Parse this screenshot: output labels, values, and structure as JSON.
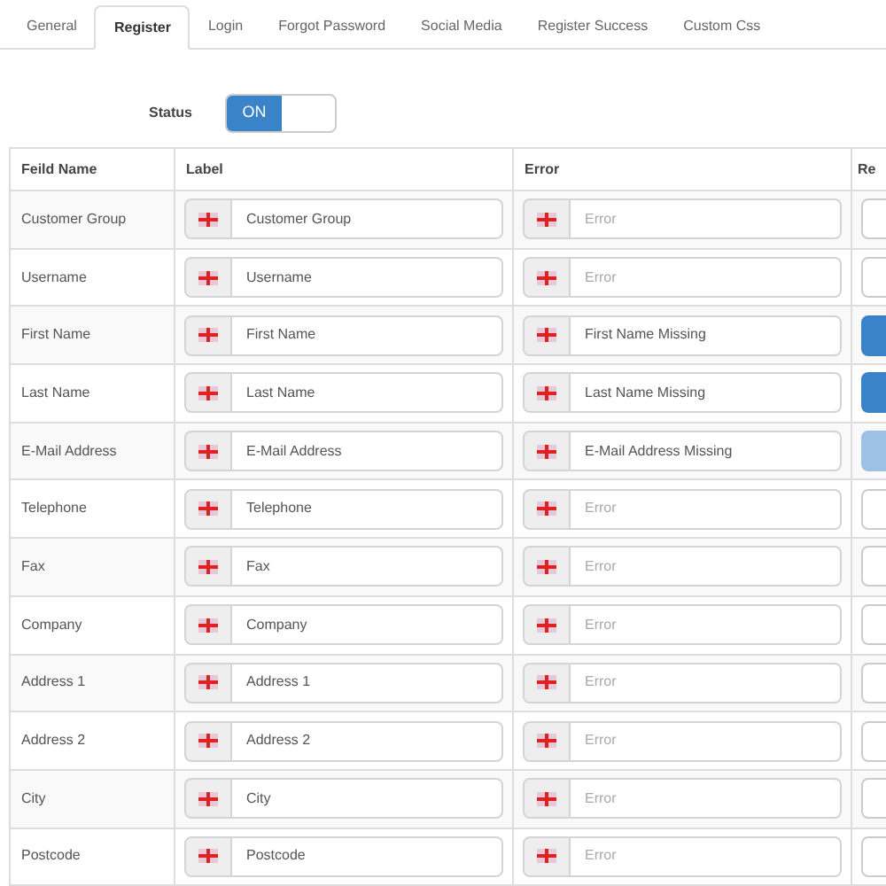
{
  "tabs": [
    {
      "label": "General",
      "selected": false
    },
    {
      "label": "Register",
      "selected": true
    },
    {
      "label": "Login",
      "selected": false
    },
    {
      "label": "Forgot Password",
      "selected": false
    },
    {
      "label": "Social Media",
      "selected": false
    },
    {
      "label": "Register Success",
      "selected": false
    },
    {
      "label": "Custom Css",
      "selected": false
    }
  ],
  "status": {
    "label": "Status",
    "toggle_text": "ON",
    "on": true
  },
  "table": {
    "columns": [
      "Feild Name",
      "Label",
      "Error",
      "Re"
    ],
    "rows": [
      {
        "field": "Customer Group",
        "label": "Customer Group",
        "error_placeholder": "Error",
        "required": false,
        "disabled": false
      },
      {
        "field": "Username",
        "label": "Username",
        "error_placeholder": "Error",
        "required": false,
        "disabled": false
      },
      {
        "field": "First Name",
        "label": "First Name",
        "error": "First Name Missing",
        "required": true,
        "disabled": false
      },
      {
        "field": "Last Name",
        "label": "Last Name",
        "error": "Last Name Missing",
        "required": true,
        "disabled": false
      },
      {
        "field": "E-Mail Address",
        "label": "E-Mail Address",
        "error": "E-Mail Address Missing",
        "required": true,
        "disabled": true
      },
      {
        "field": "Telephone",
        "label": "Telephone",
        "error_placeholder": "Error",
        "required": false,
        "disabled": false
      },
      {
        "field": "Fax",
        "label": "Fax",
        "error_placeholder": "Error",
        "required": false,
        "disabled": false
      },
      {
        "field": "Company",
        "label": "Company",
        "error_placeholder": "Error",
        "required": false,
        "disabled": false
      },
      {
        "field": "Address 1",
        "label": "Address 1",
        "error_placeholder": "Error",
        "required": false,
        "disabled": false
      },
      {
        "field": "Address 2",
        "label": "Address 2",
        "error_placeholder": "Error",
        "required": false,
        "disabled": false
      },
      {
        "field": "City",
        "label": "City",
        "error_placeholder": "Error",
        "required": false,
        "disabled": false
      },
      {
        "field": "Postcode",
        "label": "Postcode",
        "error_placeholder": "Error",
        "required": false,
        "disabled": false
      }
    ]
  }
}
